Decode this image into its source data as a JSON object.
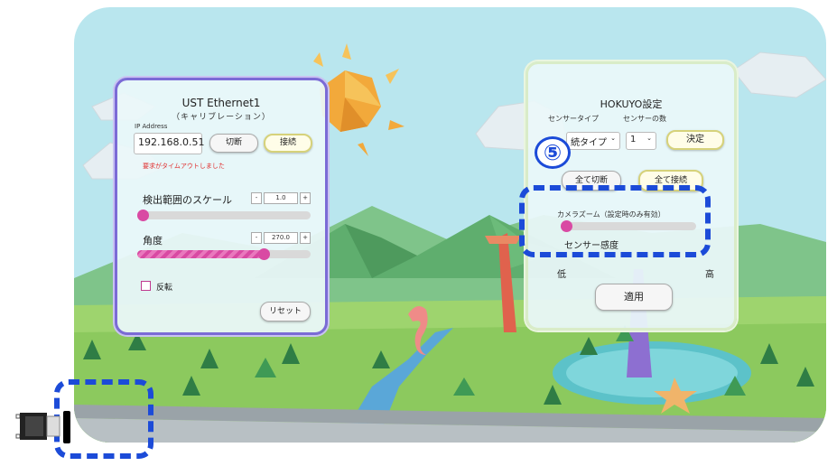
{
  "left_panel": {
    "title": "UST Ethernet1",
    "subtitle": "（キャリブレーション）",
    "ip_label": "IP Address",
    "ip_value": "192.168.0.51",
    "disconnect_label": "切断",
    "connect_label": "接続",
    "error_text": "要求がタイムアウトしました",
    "scale_label": "検出範囲のスケール",
    "scale_value": "1.0",
    "scale_level": 0.0,
    "angle_label": "角度",
    "angle_value": "270.0",
    "angle_level": 0.75,
    "minus": "-",
    "plus": "+",
    "invert_label": "反転",
    "reset_label": "リセット"
  },
  "right_panel": {
    "title": "HOKUYO設定",
    "sensor_type_label": "センサータイプ",
    "sensor_count_label": "センサーの数",
    "sensor_type_value": "続タイプ",
    "sensor_count_value": "1",
    "decide_label": "決定",
    "all_disconnect_label": "全て切断",
    "all_connect_label": "全て接続",
    "camera_zoom_label": "カメラズーム（設定時のみ有効）",
    "camera_zoom_level": 0.0,
    "sensitivity_label": "センサー感度",
    "low_label": "低",
    "high_label": "高",
    "apply_label": "適用"
  },
  "annotation": {
    "step_number": "⑤"
  },
  "colors": {
    "sky": "#b9e6ee",
    "accent_pink": "#d94aa3",
    "annotation_blue": "#1c4bd8",
    "left_border": "#7b6bd6",
    "error_red": "#e03030"
  }
}
